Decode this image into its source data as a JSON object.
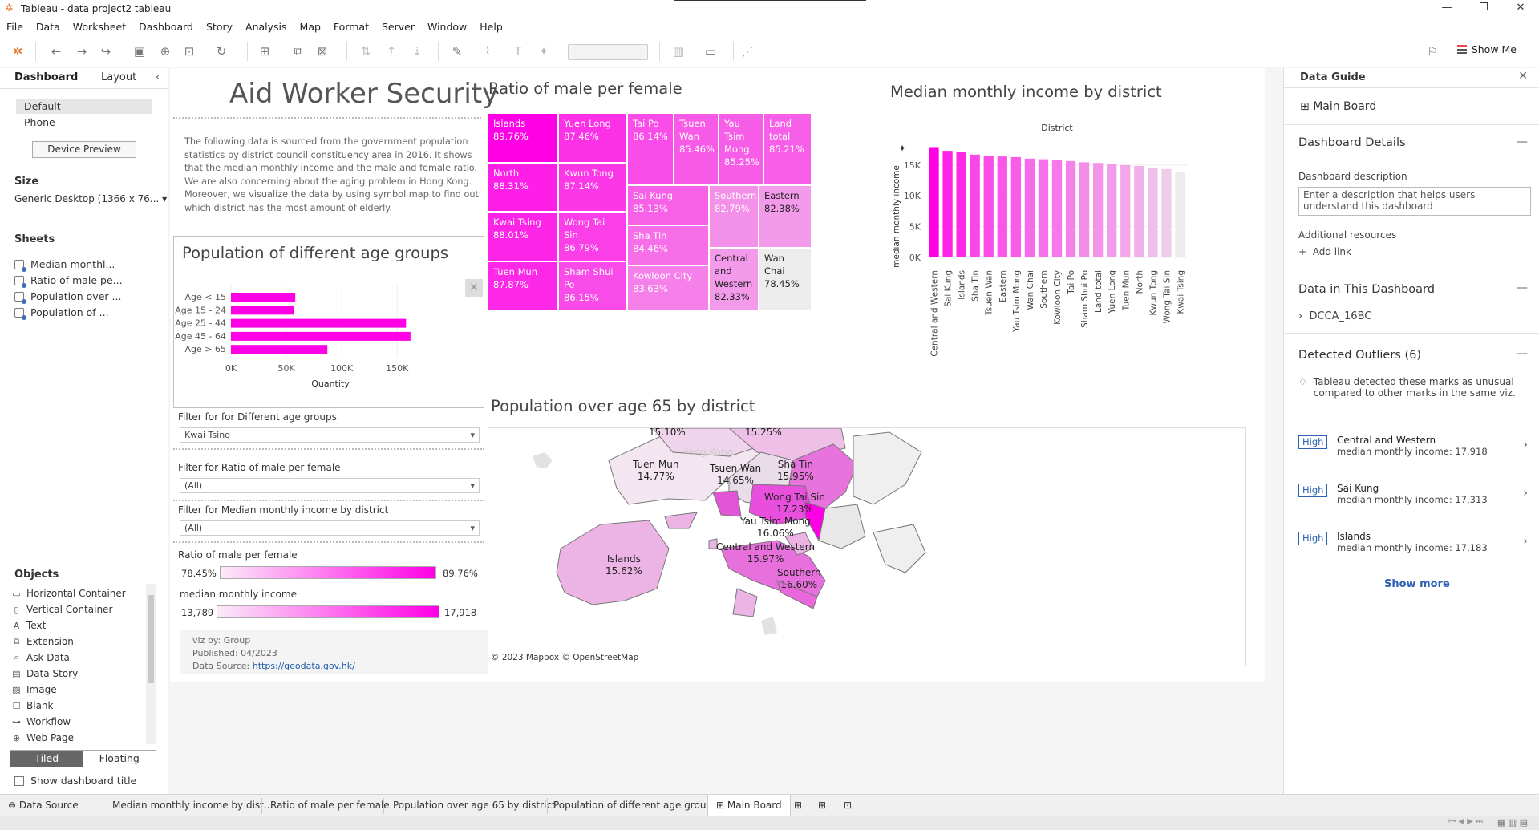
{
  "window": {
    "title": "Tableau - data project2 tableau"
  },
  "menu": [
    "File",
    "Data",
    "Worksheet",
    "Dashboard",
    "Story",
    "Analysis",
    "Map",
    "Format",
    "Server",
    "Window",
    "Help"
  ],
  "toolbar": {
    "show_me": "Show Me"
  },
  "left": {
    "tab_dashboard": "Dashboard",
    "tab_layout": "Layout",
    "device_default": "Default",
    "device_phone": "Phone",
    "device_preview": "Device Preview",
    "size_heading": "Size",
    "size_value": "Generic Desktop (1366 x 76...",
    "sheets_heading": "Sheets",
    "sheets": [
      "Median monthl...",
      "Ratio of male pe...",
      "Population over ...",
      "Population of ..."
    ],
    "objects_heading": "Objects",
    "objects": [
      {
        "icon": "horizontal-container-icon",
        "label": "Horizontal Container"
      },
      {
        "icon": "vertical-container-icon",
        "label": "Vertical Container"
      },
      {
        "icon": "text-icon",
        "label": "Text"
      },
      {
        "icon": "extension-icon",
        "label": "Extension"
      },
      {
        "icon": "ask-data-icon",
        "label": "Ask Data"
      },
      {
        "icon": "data-story-icon",
        "label": "Data Story"
      },
      {
        "icon": "image-icon",
        "label": "Image"
      },
      {
        "icon": "blank-icon",
        "label": "Blank"
      },
      {
        "icon": "workflow-icon",
        "label": "Workflow"
      },
      {
        "icon": "web-page-icon",
        "label": "Web Page"
      }
    ],
    "tiled": "Tiled",
    "floating": "Floating",
    "show_title": "Show dashboard title"
  },
  "dashboard": {
    "title": "Aid Worker Security",
    "description": "The following data is sourced from the government population statistics by district council constituency area in 2016. It shows that the median monthly income and the male and female ratio. We are also concerning about the aging problem in Hong Kong. Moreover, we visualize the data by using symbol map to find out which district has the most amount of elderly.",
    "age_chart_title": "Population of different age groups",
    "treemap_title": "Ratio of male per female",
    "income_title": "Median monthly income by district",
    "map_title": "Population over age 65 by district",
    "filter1_label": "Filter for  for Different age groups",
    "filter1_value": "Kwai Tsing",
    "filter2_label": "Filter for Ratio of male per female",
    "filter2_value": "(All)",
    "filter3_label": "Filter for Median monthly income by district",
    "filter3_value": "(All)",
    "legend1_label": "Ratio of male per female",
    "legend1_min": "78.45%",
    "legend1_max": "89.76%",
    "legend2_label": "median monthly income",
    "legend2_min": "13,789",
    "legend2_max": "17,918",
    "credit_by": "viz by: Group",
    "credit_published": "Published: 04/2023",
    "credit_source_label": "Data Source:",
    "credit_source_link": "https://geodata.gov.hk/",
    "map_credit": "© 2023 Mapbox © OpenStreetMap",
    "accent": "#ff00e6"
  },
  "chart_data": [
    {
      "type": "bar",
      "orientation": "horizontal",
      "title": "Population of different age groups",
      "categories": [
        "Age < 15",
        "Age 15 - 24",
        "Age 25 - 44",
        "Age 45 - 64",
        "Age > 65"
      ],
      "values": [
        58000,
        57000,
        158000,
        162000,
        87000
      ],
      "xlabel": "Quantity",
      "xticks": [
        "0K",
        "50K",
        "100K",
        "150K"
      ],
      "xlim": [
        0,
        165000
      ]
    },
    {
      "type": "treemap",
      "title": "Ratio of male per female",
      "cells": [
        {
          "name": "Islands",
          "value": "89.76%"
        },
        {
          "name": "North",
          "value": "88.31%"
        },
        {
          "name": "Kwai Tsing",
          "value": "88.01%"
        },
        {
          "name": "Tuen Mun",
          "value": "87.87%"
        },
        {
          "name": "Yuen Long",
          "value": "87.46%"
        },
        {
          "name": "Kwun Tong",
          "value": "87.14%"
        },
        {
          "name": "Wong Tai Sin",
          "value": "86.79%"
        },
        {
          "name": "Sham Shui Po",
          "value": "86.15%"
        },
        {
          "name": "Tai Po",
          "value": "86.14%"
        },
        {
          "name": "Tsuen Wan",
          "value": "85.46%"
        },
        {
          "name": "Yau Tsim Mong",
          "value": "85.25%"
        },
        {
          "name": "Land total",
          "value": "85.21%"
        },
        {
          "name": "Sai Kung",
          "value": "85.13%"
        },
        {
          "name": "Southern",
          "value": "82.79%"
        },
        {
          "name": "Eastern",
          "value": "82.38%"
        },
        {
          "name": "Sha Tin",
          "value": "84.46%"
        },
        {
          "name": "Kowloon City",
          "value": "83.63%"
        },
        {
          "name": "Central and Western",
          "value": "82.33%"
        },
        {
          "name": "Wan Chai",
          "value": "78.45%"
        }
      ]
    },
    {
      "type": "bar",
      "title": "Median monthly income by district",
      "xlabel": "District",
      "ylabel": "median monthly income",
      "yticks": [
        "0K",
        "5K",
        "10K",
        "15K"
      ],
      "ylim": [
        0,
        18500
      ],
      "categories": [
        "Central and Western",
        "Sai Kung",
        "Islands",
        "Sha Tin",
        "Tsuen Wan",
        "Eastern",
        "Yau Tsim Mong",
        "Wan Chai",
        "Southern",
        "Kowloon City",
        "Tai Po",
        "Sham Shui Po",
        "Land total",
        "Yuen Long",
        "Tuen Mun",
        "North",
        "Kwun Tong",
        "Wong Tai Sin",
        "Kwai Tsing"
      ],
      "values": [
        17918,
        17313,
        17183,
        16700,
        16550,
        16400,
        16300,
        16050,
        15950,
        15800,
        15650,
        15450,
        15350,
        15200,
        15000,
        14850,
        14600,
        14350,
        13789
      ]
    }
  ],
  "map_labels": [
    {
      "name": "",
      "value": "15.10%"
    },
    {
      "name": "",
      "value": "15.25%"
    },
    {
      "name": "Tuen Mun",
      "value": "14.77%"
    },
    {
      "name": "Tsuen Wan",
      "value": "14.65%"
    },
    {
      "name": "Sha Tin",
      "value": "15.95%"
    },
    {
      "name": "Wong Tai Sin",
      "value": "17.23%"
    },
    {
      "name": "Yau Tsim Mong",
      "value": "16.06%"
    },
    {
      "name": "Central and Western",
      "value": "15.97%"
    },
    {
      "name": "Islands",
      "value": "15.62%"
    },
    {
      "name": "Southern",
      "value": "16.60%"
    }
  ],
  "map_bg_label": "Hong Kong",
  "right": {
    "title": "Data Guide",
    "main_board": "Main Board",
    "details_heading": "Dashboard Details",
    "desc_label": "Dashboard description",
    "desc_placeholder": "Enter a description that helps users understand this dashboard",
    "resources": "Additional resources",
    "add_link": "Add link",
    "data_heading": "Data in This Dashboard",
    "datasource": "DCCA_16BC",
    "outliers_heading": "Detected Outliers (6)",
    "outliers_note": "Tableau detected these marks as unusual compared to other marks in the same viz.",
    "outliers": [
      {
        "badge": "High",
        "name": "Central and Western",
        "value": "median monthly income: 17,918"
      },
      {
        "badge": "High",
        "name": "Sai Kung",
        "value": "median monthly income: 17,313"
      },
      {
        "badge": "High",
        "name": "Islands",
        "value": "median monthly income: 17,183"
      }
    ],
    "show_more": "Show more"
  },
  "bottom_tabs": {
    "data_source": "Data Source",
    "sheets": [
      "Median monthly income by dist...",
      "Ratio of male per female",
      "Population over age 65 by district",
      "Population of different age group"
    ],
    "active": "Main Board"
  }
}
